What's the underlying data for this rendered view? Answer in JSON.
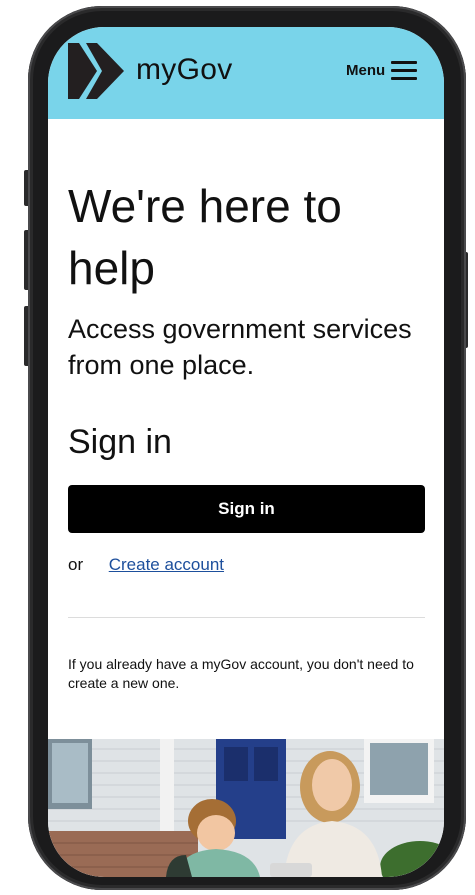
{
  "header": {
    "logo_text": "myGov",
    "logo_icon": "mygov-chevron-logo-icon",
    "menu_label": "Menu",
    "menu_icon": "hamburger-menu-icon",
    "background_color": "#79d4ea"
  },
  "main": {
    "headline": "We're here to help",
    "subtitle": "Access government services from one place.",
    "section_title": "Sign in",
    "signin_button_label": "Sign in",
    "or_text": "or",
    "create_account_link": "Create account",
    "info_text": "If you already have a myGov account, you don't need to create a new one."
  },
  "hero_image": {
    "description_icon": "family-photo"
  },
  "colors": {
    "accent": "#79d4ea",
    "button": "#000000",
    "link": "#1d4f9c"
  }
}
